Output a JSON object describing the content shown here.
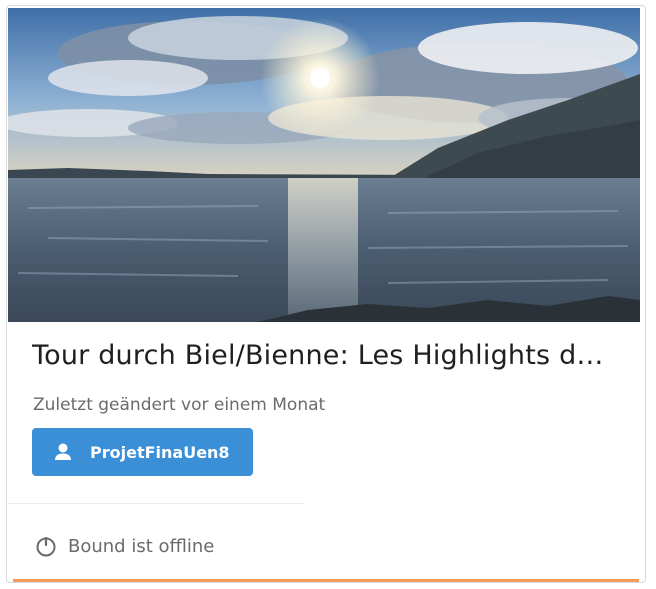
{
  "card": {
    "image_alt": "Blick auf den See bei Sonnenschein",
    "title": "Tour durch Biel/Bienne: Les Highlights d…",
    "subtitle": "Zuletzt geändert vor einem Monat",
    "owner_button": {
      "icon": "user-icon",
      "label": "ProjetFinaUen8"
    },
    "status": {
      "icon": "power-icon",
      "text": "Bound ist offline"
    }
  },
  "colors": {
    "button": "#3a8fd6",
    "accent": "#f08a3e",
    "title": "#1f1f1f",
    "muted": "#6b6b6b"
  }
}
